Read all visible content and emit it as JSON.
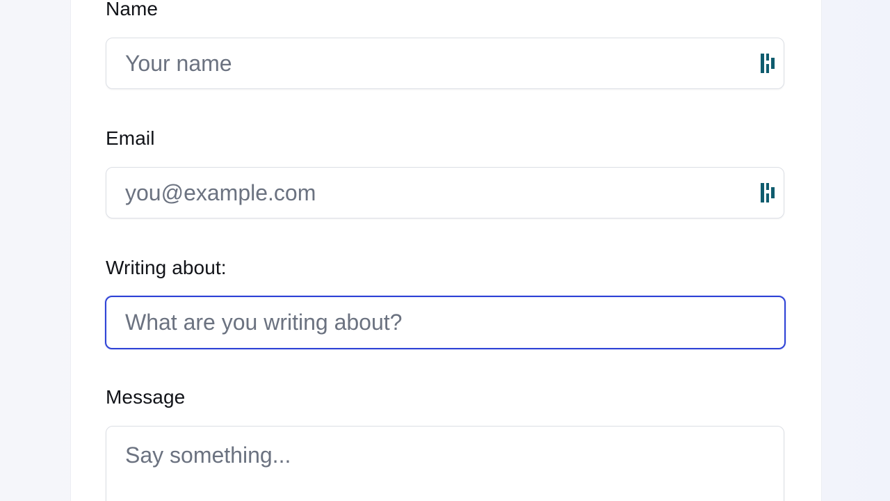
{
  "form": {
    "name": {
      "label": "Name",
      "placeholder": "Your name",
      "value": ""
    },
    "email": {
      "label": "Email",
      "placeholder": "you@example.com",
      "value": ""
    },
    "topic": {
      "label": "Writing about:",
      "placeholder": "What are you writing about?",
      "value": ""
    },
    "message": {
      "label": "Message",
      "placeholder": "Say something...",
      "value": ""
    }
  },
  "icons": {
    "password_manager": "password-manager-icon"
  },
  "colors": {
    "focus_border": "#2f43d6",
    "icon_teal": "#0f5c6e",
    "label_text": "#111318",
    "placeholder_text": "#6b7280"
  }
}
